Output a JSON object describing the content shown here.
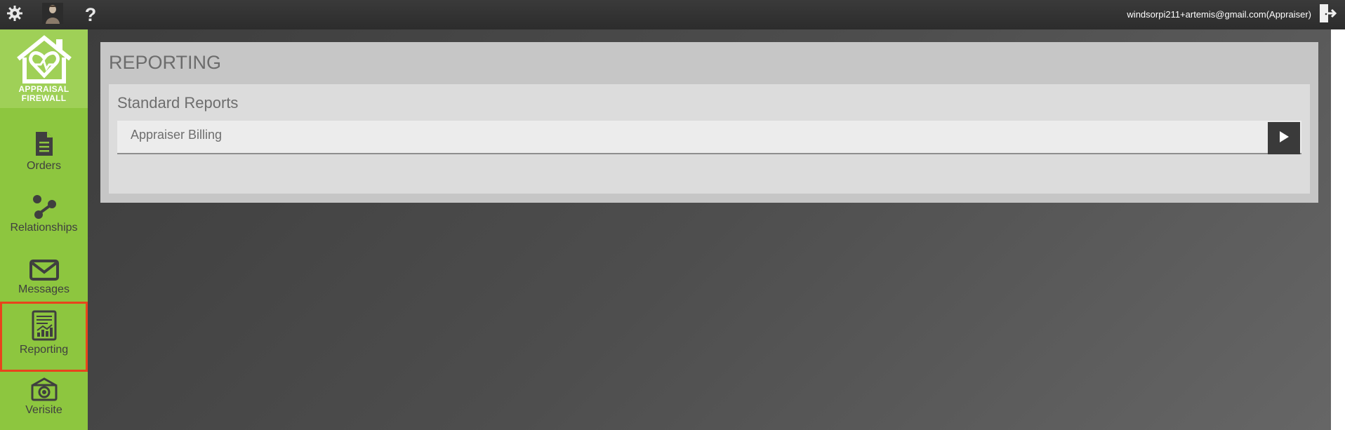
{
  "topbar": {
    "user_label": "windsorpi211+artemis@gmail.com(Appraiser)",
    "icons": [
      "gear-icon",
      "avatar",
      "help-icon",
      "logout-icon"
    ],
    "help_glyph": "?"
  },
  "sidebar": {
    "logo": {
      "line1": "APPRAISAL",
      "line2": "FIREWALL"
    },
    "items": [
      {
        "label": "Orders",
        "icon": "document-icon"
      },
      {
        "label": "Relationships",
        "icon": "connection-icon"
      },
      {
        "label": "Messages",
        "icon": "envelope-icon"
      },
      {
        "label": "Reporting",
        "icon": "report-chart-icon",
        "active": true
      },
      {
        "label": "Verisite",
        "icon": "camera-icon"
      }
    ],
    "colors": {
      "background": "#8dc63f",
      "active_outline": "#e8441c"
    }
  },
  "main": {
    "page_title": "REPORTING",
    "section_title": "Standard Reports",
    "reports": [
      {
        "label": "Appraiser Billing",
        "action_icon": "play-icon"
      }
    ]
  }
}
